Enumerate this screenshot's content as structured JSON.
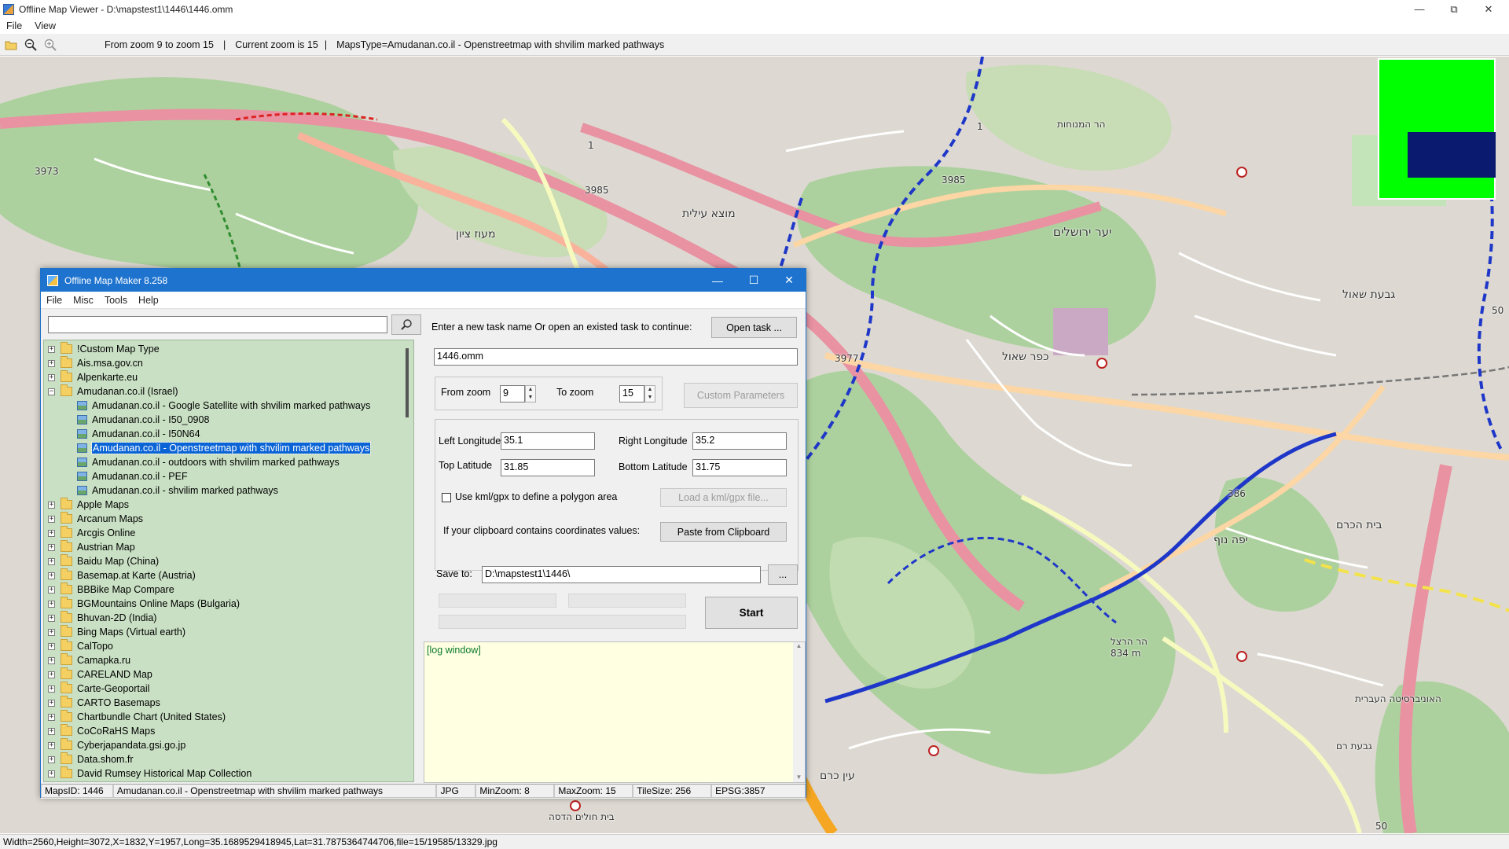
{
  "viewer": {
    "title": "Offline Map Viewer - D:\\mapstest1\\1446\\1446.omm",
    "menu": [
      "File",
      "View"
    ],
    "toolbar": {
      "zoom_range": "From zoom 9 to zoom 15",
      "separator1": "|",
      "current_zoom": "Current zoom is 15",
      "separator2": "|",
      "maps_type": "MapsType=Amudanan.co.il - Openstreetmap with shvilim marked pathways"
    },
    "status": "Width=2560,Height=3072,X=1832,Y=1957,Long=35.1689529418945,Lat=31.7875364744706,file=15/19585/13329.jpg"
  },
  "map": {
    "labels": [
      "3973",
      "3985",
      "3977",
      "3985",
      "386",
      "1",
      "1",
      "50",
      "50",
      "יער ירושלים",
      "כפר שאול",
      "מעוז ציון",
      "מוצא עילית",
      "גבעת שאול",
      "בית הכרם",
      "עין כרם",
      "הר המנוחות",
      "יפה נוף",
      "834 m",
      "הר הרצל",
      "בית חולים הדסה",
      "גבעת רם",
      "האוניברסיטה העברית"
    ],
    "colors": {
      "background": "#e8e4dc",
      "forest": "#add19e",
      "residential": "#ddd9d2",
      "motorway": "#e892a2",
      "primary": "#fcd6a4",
      "trunk": "#f9b29c",
      "trail_blue": "#1e37c8",
      "trail_green": "#2e8b2e",
      "trail_red": "#d22",
      "trail_yellow": "#f3e24a",
      "overview_bg": "#00ff00",
      "overview_rect": "#0a1a6e"
    }
  },
  "dialog": {
    "title": "Offline Map Maker 8.258",
    "menu": [
      "File",
      "Misc",
      "Tools",
      "Help"
    ],
    "search": {
      "value": "",
      "placeholder": ""
    },
    "tree": [
      {
        "label": "!Custom Map Type",
        "level": 0,
        "expanded": false
      },
      {
        "label": "Ais.msa.gov.cn",
        "level": 0,
        "expanded": false
      },
      {
        "label": "Alpenkarte.eu",
        "level": 0,
        "expanded": false
      },
      {
        "label": "Amudanan.co.il (Israel)",
        "level": 0,
        "expanded": true
      },
      {
        "label": "Amudanan.co.il - Google Satellite with shvilim marked pathways",
        "level": 1
      },
      {
        "label": "Amudanan.co.il - I50_0908",
        "level": 1
      },
      {
        "label": "Amudanan.co.il - I50N64",
        "level": 1
      },
      {
        "label": "Amudanan.co.il - Openstreetmap with shvilim marked pathways",
        "level": 1,
        "selected": true
      },
      {
        "label": "Amudanan.co.il - outdoors with shvilim marked pathways",
        "level": 1
      },
      {
        "label": "Amudanan.co.il - PEF",
        "level": 1
      },
      {
        "label": "Amudanan.co.il - shvilim marked pathways",
        "level": 1
      },
      {
        "label": "Apple Maps",
        "level": 0,
        "expanded": false
      },
      {
        "label": "Arcanum Maps",
        "level": 0,
        "expanded": false
      },
      {
        "label": "Arcgis Online",
        "level": 0,
        "expanded": false
      },
      {
        "label": "Austrian Map",
        "level": 0,
        "expanded": false
      },
      {
        "label": "Baidu Map (China)",
        "level": 0,
        "expanded": false
      },
      {
        "label": "Basemap.at Karte (Austria)",
        "level": 0,
        "expanded": false
      },
      {
        "label": "BBBike Map Compare",
        "level": 0,
        "expanded": false
      },
      {
        "label": "BGMountains Online Maps (Bulgaria)",
        "level": 0,
        "expanded": false
      },
      {
        "label": "Bhuvan-2D (India)",
        "level": 0,
        "expanded": false
      },
      {
        "label": "Bing Maps (Virtual earth)",
        "level": 0,
        "expanded": false
      },
      {
        "label": "CalTopo",
        "level": 0,
        "expanded": false
      },
      {
        "label": "Camapka.ru",
        "level": 0,
        "expanded": false
      },
      {
        "label": "CARELAND Map",
        "level": 0,
        "expanded": false
      },
      {
        "label": "Carte-Geoportail",
        "level": 0,
        "expanded": false
      },
      {
        "label": "CARTO Basemaps",
        "level": 0,
        "expanded": false
      },
      {
        "label": "Chartbundle Chart (United States)",
        "level": 0,
        "expanded": false
      },
      {
        "label": "CoCoRaHS Maps",
        "level": 0,
        "expanded": false
      },
      {
        "label": "Cyberjapandata.gsi.go.jp",
        "level": 0,
        "expanded": false
      },
      {
        "label": "Data.shom.fr",
        "level": 0,
        "expanded": false
      },
      {
        "label": "David Rumsey Historical Map Collection",
        "level": 0,
        "expanded": false
      }
    ],
    "task": {
      "prompt": "Enter a new task name Or open an existed task to continue:",
      "open_button": "Open task ...",
      "name_value": "1446.omm"
    },
    "zoom": {
      "from_label": "From zoom",
      "from_value": "9",
      "to_label": "To zoom",
      "to_value": "15",
      "custom_button": "Custom Parameters"
    },
    "coords": {
      "left_lon_label": "Left Longitude",
      "left_lon_value": "35.1",
      "right_lon_label": "Right Longitude",
      "right_lon_value": "35.2",
      "top_lat_label": "Top Latitude",
      "top_lat_value": "31.85",
      "bottom_lat_label": "Bottom Latitude",
      "bottom_lat_value": "31.75",
      "kml_checkbox_label": "Use kml/gpx to define a polygon area",
      "kml_button": "Load a kml/gpx file...",
      "clipboard_prompt": "If your clipboard contains coordinates values:",
      "clipboard_button": "Paste from Clipboard"
    },
    "save": {
      "label": "Save to:",
      "value": "D:\\mapstest1\\1446\\",
      "browse_button": "..."
    },
    "start_button": "Start",
    "log": "[log window]",
    "status": {
      "maps_id": "MapsID: 1446",
      "maps_name": "Amudanan.co.il - Openstreetmap with shvilim marked pathways",
      "format": "JPG",
      "min_zoom": "MinZoom: 8",
      "max_zoom": "MaxZoom: 15",
      "tile_size": "TileSize: 256",
      "epsg": "EPSG:3857"
    }
  }
}
